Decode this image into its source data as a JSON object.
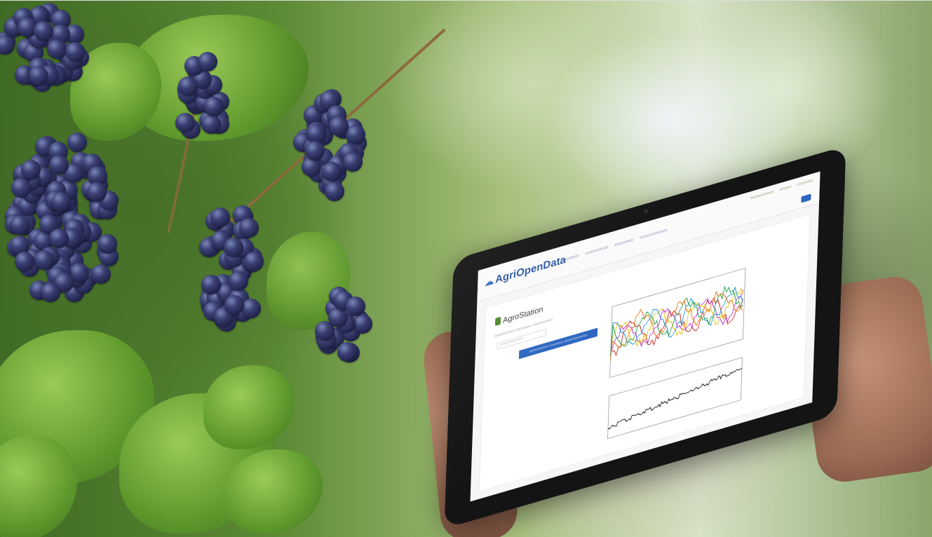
{
  "scene": {
    "description_colors": {
      "foliage": "#5f9a2c",
      "grape": "#1e2147",
      "tablet_bezel": "#141414",
      "accent_blue": "#2e67c1"
    }
  },
  "tablet_app": {
    "logo": "AgriOpenData",
    "station_title": "AgroStation",
    "icons": [
      "logo-icon",
      "station-icon"
    ]
  }
}
